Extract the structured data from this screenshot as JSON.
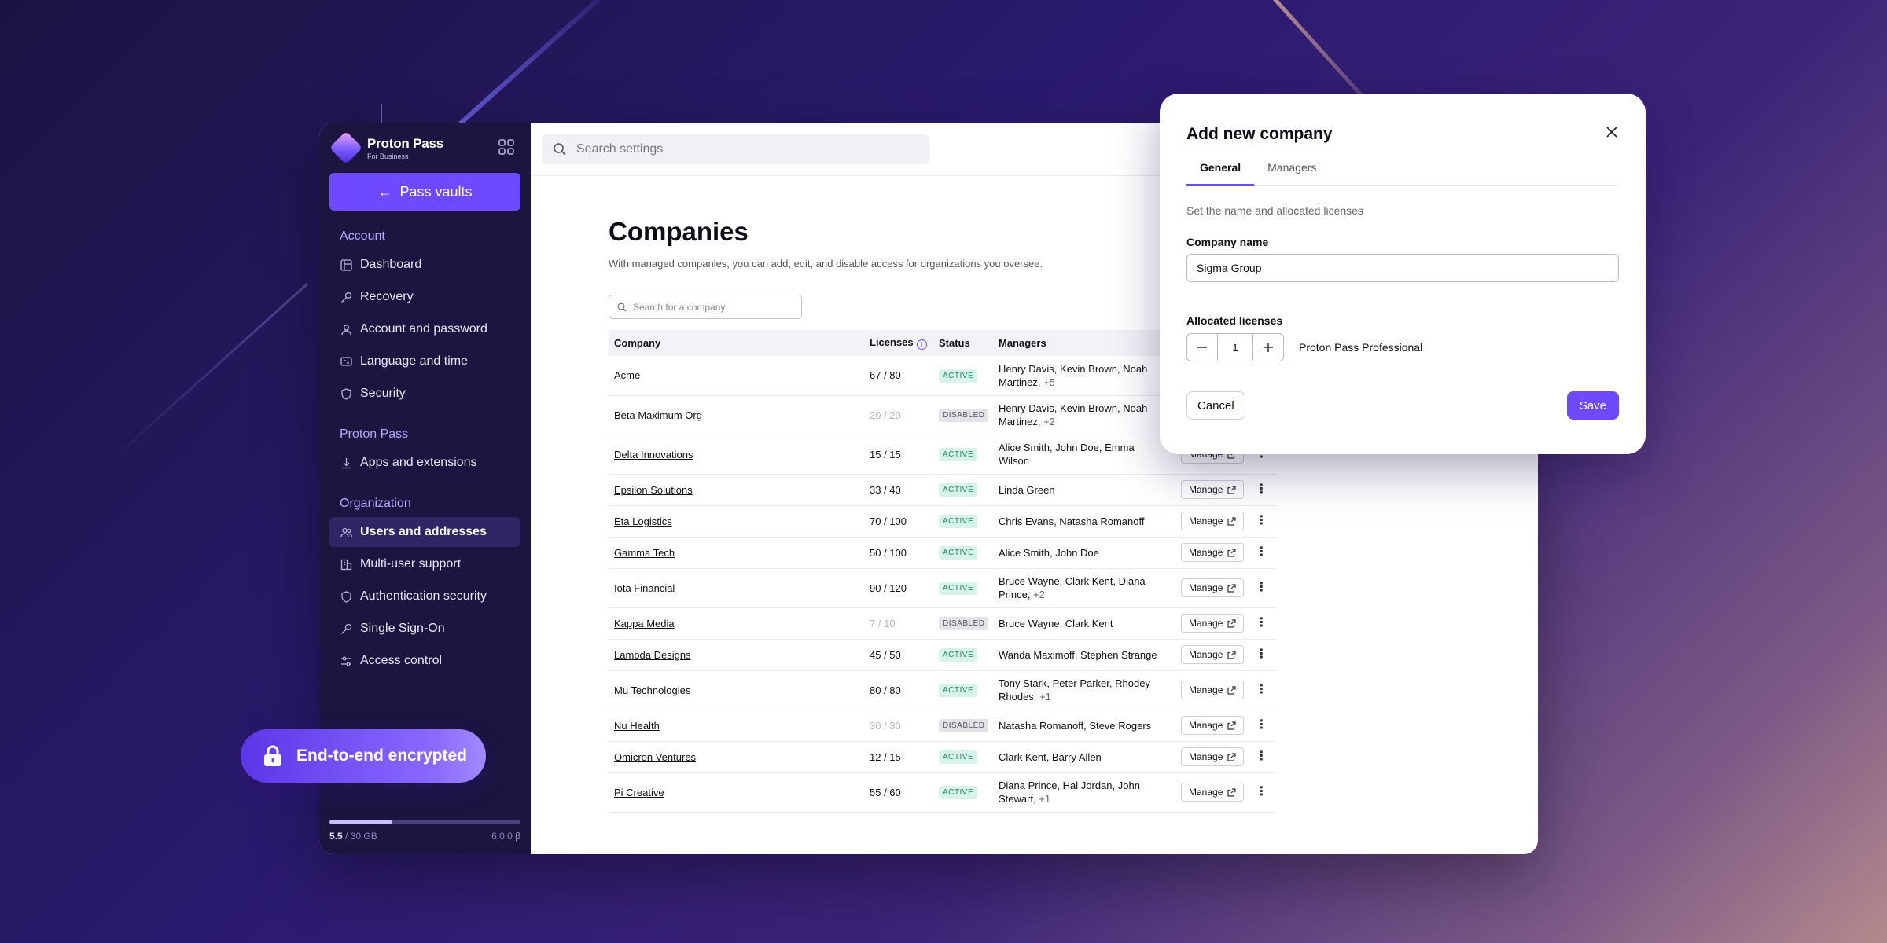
{
  "brand": {
    "name": "Proton Pass",
    "sub": "For Business"
  },
  "sidebar": {
    "vault_button": "Pass vaults",
    "sections": [
      {
        "title": "Account",
        "items": [
          {
            "label": "Dashboard",
            "icon": "dashboard-icon"
          },
          {
            "label": "Recovery",
            "icon": "key-icon"
          },
          {
            "label": "Account and password",
            "icon": "user-icon"
          },
          {
            "label": "Language and time",
            "icon": "language-icon"
          },
          {
            "label": "Security",
            "icon": "shield-icon"
          }
        ]
      },
      {
        "title": "Proton Pass",
        "items": [
          {
            "label": "Apps and extensions",
            "icon": "download-icon"
          }
        ]
      },
      {
        "title": "Organization",
        "items": [
          {
            "label": "Users and addresses",
            "icon": "users-icon",
            "active": true
          },
          {
            "label": "Multi-user support",
            "icon": "building-icon"
          },
          {
            "label": "Authentication security",
            "icon": "shield-icon"
          },
          {
            "label": "Single Sign-On",
            "icon": "key-icon"
          },
          {
            "label": "Access control",
            "icon": "sliders-icon"
          }
        ]
      }
    ],
    "storage": {
      "used": "5.5",
      "total": "/ 30 GB",
      "version": "6.0.0 β",
      "fraction": 0.33
    }
  },
  "topbar": {
    "search_placeholder": "Search settings"
  },
  "page": {
    "title": "Companies",
    "description": "With managed companies, you can add, edit, and disable access for organizations you oversee.",
    "search_placeholder": "Search for a company"
  },
  "table": {
    "headers": {
      "company": "Company",
      "licenses": "Licenses",
      "status": "Status",
      "managers": "Managers"
    },
    "manage_label": "Manage",
    "rows": [
      {
        "company": "Acme",
        "licenses": "67 / 80",
        "status": "ACTIVE",
        "managers": "Henry Davis, Kevin Brown, Noah Martinez,",
        "more": "+5"
      },
      {
        "company": "Beta Maximum Org",
        "licenses": "20 / 20",
        "status": "DISABLED",
        "managers": "Henry Davis, Kevin Brown, Noah Martinez,",
        "more": "+2"
      },
      {
        "company": "Delta Innovations",
        "licenses": "15 / 15",
        "status": "ACTIVE",
        "managers": "Alice Smith, John Doe, Emma Wilson",
        "more": ""
      },
      {
        "company": "Epsilon Solutions",
        "licenses": "33 / 40",
        "status": "ACTIVE",
        "managers": "Linda Green",
        "more": ""
      },
      {
        "company": "Eta Logistics",
        "licenses": "70 / 100",
        "status": "ACTIVE",
        "managers": "Chris Evans, Natasha Romanoff",
        "more": ""
      },
      {
        "company": "Gamma Tech",
        "licenses": "50 / 100",
        "status": "ACTIVE",
        "managers": "Alice Smith, John Doe",
        "more": ""
      },
      {
        "company": "Iota Financial",
        "licenses": "90 / 120",
        "status": "ACTIVE",
        "managers": "Bruce Wayne, Clark Kent, Diana Prince,",
        "more": "+2"
      },
      {
        "company": "Kappa Media",
        "licenses": "7 / 10",
        "status": "DISABLED",
        "managers": "Bruce Wayne, Clark Kent",
        "more": ""
      },
      {
        "company": "Lambda Designs",
        "licenses": "45 / 50",
        "status": "ACTIVE",
        "managers": "Wanda Maximoff, Stephen Strange",
        "more": ""
      },
      {
        "company": "Mu Technologies",
        "licenses": "80 / 80",
        "status": "ACTIVE",
        "managers": "Tony Stark, Peter Parker, Rhodey Rhodes,",
        "more": "+1"
      },
      {
        "company": "Nu Health",
        "licenses": "30 / 30",
        "status": "DISABLED",
        "managers": "Natasha Romanoff, Steve Rogers",
        "more": ""
      },
      {
        "company": "Omicron Ventures",
        "licenses": "12 / 15",
        "status": "ACTIVE",
        "managers": "Clark Kent, Barry Allen",
        "more": ""
      },
      {
        "company": "Pi Creative",
        "licenses": "55 / 60",
        "status": "ACTIVE",
        "managers": "Diana Prince, Hal Jordan, John Stewart,",
        "more": "+1"
      }
    ]
  },
  "modal": {
    "title": "Add new company",
    "tabs": [
      "General",
      "Managers"
    ],
    "hint": "Set the name and allocated licenses",
    "company_label": "Company name",
    "company_value": "Sigma Group",
    "licenses_label": "Allocated licenses",
    "licenses_value": "1",
    "plan": "Proton Pass Professional",
    "cancel": "Cancel",
    "save": "Save"
  },
  "badge": {
    "text": "End-to-end encrypted"
  },
  "colors": {
    "accent": "#6d4aff",
    "sidebar_bg": "#1c1540",
    "active_badge": "#1b8a5f"
  }
}
